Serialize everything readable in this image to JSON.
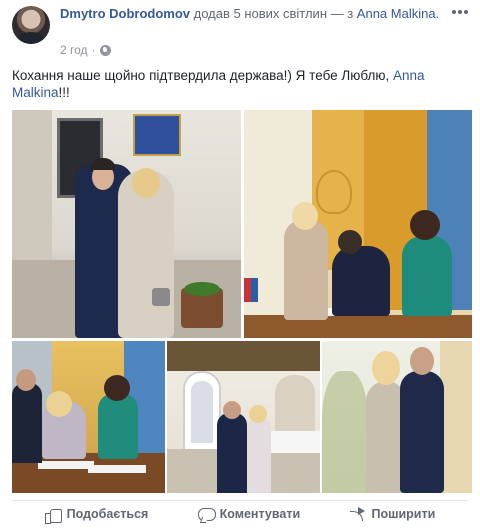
{
  "post": {
    "author": "Dmytro Dobrodomov",
    "header_action": " додав 5 нових світлин — з ",
    "tagged_person": "Anna Malkina",
    "header_end": ".",
    "time": "2 год",
    "privacy_icon": "globe-icon",
    "menu_icon": "more-horizontal-icon",
    "text_part1": "Кохання наше щойно підтвердила держава!) Я тебе Люблю, ",
    "text_tagged": "Anna Malkina",
    "text_part2": "!!!"
  },
  "actions": {
    "like_label": "Подобається",
    "comment_label": "Коментувати",
    "share_label": "Поширити"
  },
  "colors": {
    "link": "#365899",
    "meta": "#90949c",
    "action": "#606770"
  }
}
